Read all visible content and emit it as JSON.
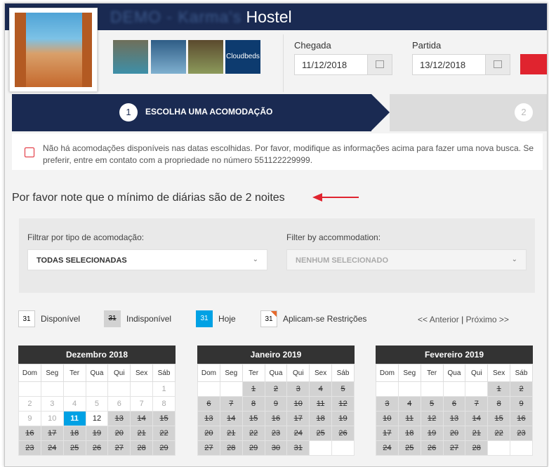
{
  "header": {
    "title_blurred": "DEMO - Karma's",
    "title": "Hostel",
    "thumb4_text": "Cloudbeds"
  },
  "search": {
    "arrival_label": "Chegada",
    "arrival_value": "11/12/2018",
    "departure_label": "Partida",
    "departure_value": "13/12/2018"
  },
  "steps": {
    "step1_number": "1",
    "step1_label": "ESCOLHA UMA ACOMODAÇÃO",
    "step2_number": "2"
  },
  "alert": {
    "text": "Não há acomodações disponíveis nas datas escolhidas. Por favor, modifique as informações acima para fazer uma nova busca. Se preferir, entre em contato com a propriedade no número 551122229999."
  },
  "note": "Por favor note que o mínimo de diárias são de 2 noites",
  "filters": {
    "type_label": "Filtrar por tipo de acomodação:",
    "type_value": "TODAS SELECIONADAS",
    "accom_label": "Filter by accommodation:",
    "accom_value": "NENHUM SELECIONADO"
  },
  "legend": {
    "sample_day": "31",
    "available": "Disponível",
    "unavailable": "Indisponível",
    "today": "Hoje",
    "restrictions": "Aplicam-se Restrições"
  },
  "nav": {
    "prev": "<< Anterior",
    "sep": "|",
    "next": "Próximo >>"
  },
  "colors": {
    "brand_navy": "#1a2a52",
    "accent_red": "#e0242f",
    "today_blue": "#00a1e4",
    "unavailable_gray": "#d2d2d2"
  },
  "weekdays": [
    "Dom",
    "Seg",
    "Ter",
    "Qua",
    "Qui",
    "Sex",
    "Sáb"
  ],
  "months": [
    {
      "name": "Dezembro 2018",
      "weeks": [
        [
          [
            "",
            ""
          ],
          [
            "",
            ""
          ],
          [
            "",
            ""
          ],
          [
            "",
            ""
          ],
          [
            "",
            ""
          ],
          [
            "",
            ""
          ],
          [
            "1",
            "past"
          ]
        ],
        [
          [
            "2",
            "past"
          ],
          [
            "3",
            "past"
          ],
          [
            "4",
            "past"
          ],
          [
            "5",
            "past"
          ],
          [
            "6",
            "past"
          ],
          [
            "7",
            "past"
          ],
          [
            "8",
            "past"
          ]
        ],
        [
          [
            "9",
            "past"
          ],
          [
            "10",
            "past"
          ],
          [
            "11",
            "today"
          ],
          [
            "12",
            "av"
          ],
          [
            "13",
            "un"
          ],
          [
            "14",
            "un"
          ],
          [
            "15",
            "un"
          ]
        ],
        [
          [
            "16",
            "un"
          ],
          [
            "17",
            "un"
          ],
          [
            "18",
            "un"
          ],
          [
            "19",
            "un"
          ],
          [
            "20",
            "un"
          ],
          [
            "21",
            "un"
          ],
          [
            "22",
            "un"
          ]
        ],
        [
          [
            "23",
            "un"
          ],
          [
            "24",
            "un"
          ],
          [
            "25",
            "un"
          ],
          [
            "26",
            "un"
          ],
          [
            "27",
            "un"
          ],
          [
            "28",
            "un"
          ],
          [
            "29",
            "un"
          ]
        ]
      ]
    },
    {
      "name": "Janeiro 2019",
      "weeks": [
        [
          [
            "",
            ""
          ],
          [
            "",
            ""
          ],
          [
            "1",
            "un"
          ],
          [
            "2",
            "un"
          ],
          [
            "3",
            "un"
          ],
          [
            "4",
            "un"
          ],
          [
            "5",
            "un"
          ]
        ],
        [
          [
            "6",
            "un"
          ],
          [
            "7",
            "un"
          ],
          [
            "8",
            "un"
          ],
          [
            "9",
            "un"
          ],
          [
            "10",
            "un"
          ],
          [
            "11",
            "un"
          ],
          [
            "12",
            "un"
          ]
        ],
        [
          [
            "13",
            "un"
          ],
          [
            "14",
            "un"
          ],
          [
            "15",
            "un"
          ],
          [
            "16",
            "un"
          ],
          [
            "17",
            "un"
          ],
          [
            "18",
            "un"
          ],
          [
            "19",
            "un"
          ]
        ],
        [
          [
            "20",
            "un"
          ],
          [
            "21",
            "un"
          ],
          [
            "22",
            "un"
          ],
          [
            "23",
            "un"
          ],
          [
            "24",
            "un"
          ],
          [
            "25",
            "un"
          ],
          [
            "26",
            "un"
          ]
        ],
        [
          [
            "27",
            "un"
          ],
          [
            "28",
            "un"
          ],
          [
            "29",
            "un"
          ],
          [
            "30",
            "un"
          ],
          [
            "31",
            "un"
          ],
          [
            "",
            ""
          ],
          [
            "",
            ""
          ]
        ]
      ]
    },
    {
      "name": "Fevereiro 2019",
      "weeks": [
        [
          [
            "",
            ""
          ],
          [
            "",
            ""
          ],
          [
            "",
            ""
          ],
          [
            "",
            ""
          ],
          [
            "",
            ""
          ],
          [
            "1",
            "un"
          ],
          [
            "2",
            "un"
          ]
        ],
        [
          [
            "3",
            "un"
          ],
          [
            "4",
            "un"
          ],
          [
            "5",
            "un"
          ],
          [
            "6",
            "un"
          ],
          [
            "7",
            "un"
          ],
          [
            "8",
            "un"
          ],
          [
            "9",
            "un"
          ]
        ],
        [
          [
            "10",
            "un"
          ],
          [
            "11",
            "un"
          ],
          [
            "12",
            "un"
          ],
          [
            "13",
            "un"
          ],
          [
            "14",
            "un"
          ],
          [
            "15",
            "un"
          ],
          [
            "16",
            "un"
          ]
        ],
        [
          [
            "17",
            "un"
          ],
          [
            "18",
            "un"
          ],
          [
            "19",
            "un"
          ],
          [
            "20",
            "un"
          ],
          [
            "21",
            "un"
          ],
          [
            "22",
            "un"
          ],
          [
            "23",
            "un"
          ]
        ],
        [
          [
            "24",
            "un"
          ],
          [
            "25",
            "un"
          ],
          [
            "26",
            "un"
          ],
          [
            "27",
            "un"
          ],
          [
            "28",
            "un"
          ],
          [
            "",
            ""
          ],
          [
            "",
            ""
          ]
        ]
      ]
    }
  ]
}
